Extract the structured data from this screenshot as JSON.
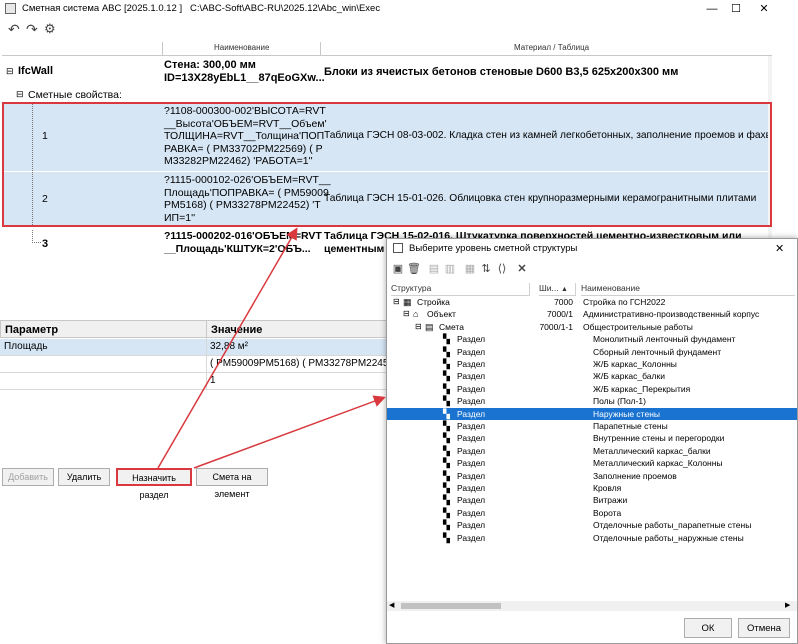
{
  "window": {
    "title": "Сметная система ABC [2025.1.0.12 ]",
    "path": "C:\\ABC-Soft\\ABC-RU\\2025.12\\Abc_win\\Exec"
  },
  "columns": {
    "name": "Наименование",
    "material": "Материал / Таблица"
  },
  "tree": {
    "root_label": "IfcWall",
    "root_name_line1": "Стена: 300,00 мм",
    "root_name_line2": "ID=13X28yEbL1__87qEoGXw...",
    "root_material": "Блоки из ячеистых бетонов стеновые D600 B3,5 625x200x300 мм",
    "props_label": "Сметные свойства:",
    "items": [
      {
        "num": "1",
        "code": [
          "?1108-000300-002'ВЫСОТА=RVT",
          "__Высота'ОБЪЕМ=RVT__Объем'",
          "ТОЛЩИНА=RVT__Толщина'ПОП",
          "РАВКА= ( PM33702PM22569)    ( P",
          "M33282PM22462)  'РАБОТА=1''"
        ],
        "table": "Таблица ГЭСН 08-03-002. Кладка стен из камней легкобетонных, заполнение проемов и фахверков"
      },
      {
        "num": "2",
        "code": [
          "?1115-000102-026'ОБЪЕМ=RVT__",
          "Площадь'ПОПРАВКА= ( PM59009",
          "PM5168)    ( PM33278PM22452)  'Т",
          "ИП=1''"
        ],
        "table": "Таблица ГЭСН 15-01-026. Облицовка стен крупноразмерными керамогранитными плитами"
      },
      {
        "num": "3",
        "code": [
          "?1115-000202-016'ОБЪЕМ=RVT",
          "__Площадь'КШТУК=2'ОБЪ..."
        ],
        "table": [
          "Таблица ГЭСН 15-02-016. Штукатурка поверхностей цементно-известковым или",
          "цементным р..."
        ]
      }
    ]
  },
  "params": {
    "col_param": "Параметр",
    "col_value": "Значение",
    "rows": [
      {
        "name": "Площадь",
        "value": "32,88  м²"
      },
      {
        "name": "",
        "value": "( PM59009PM5168)     ( PM33278PM2245"
      },
      {
        "name": "",
        "value": "1"
      }
    ]
  },
  "buttons": {
    "add": "Добавить",
    "delete": "Удалить",
    "assign": "Назначить раздел",
    "estimate": "Смета на элемент"
  },
  "dialog": {
    "title": "Выберите уровень сметной структуры",
    "col_struct": "Структура",
    "col_code": "Ши...",
    "col_name": "Наименование",
    "rows": [
      {
        "label": "Стройка",
        "code": "7000",
        "name": "Стройка по ГСН2022"
      },
      {
        "label": "Объект",
        "code": "7000/1",
        "name": "Административно-производственный корпус"
      },
      {
        "label": "Смета",
        "code": "7000/1-1",
        "name": "Общестроительные работы"
      },
      {
        "label": "Раздел",
        "code": "",
        "name": "Монолитный ленточный фундамент"
      },
      {
        "label": "Раздел",
        "code": "",
        "name": "Сборный ленточный фундамент"
      },
      {
        "label": "Раздел",
        "code": "",
        "name": "Ж/Б каркас_Колонны"
      },
      {
        "label": "Раздел",
        "code": "",
        "name": "Ж/Б каркас_балки"
      },
      {
        "label": "Раздел",
        "code": "",
        "name": "Ж/Б каркас_Перекрытия"
      },
      {
        "label": "Раздел",
        "code": "",
        "name": "Полы (Пол-1)"
      },
      {
        "label": "Раздел",
        "code": "",
        "name": "Наружные стены"
      },
      {
        "label": "Раздел",
        "code": "",
        "name": "Парапетные стены"
      },
      {
        "label": "Раздел",
        "code": "",
        "name": "Внутренние стены и перегородки"
      },
      {
        "label": "Раздел",
        "code": "",
        "name": "Металлический каркас_балки"
      },
      {
        "label": "Раздел",
        "code": "",
        "name": "Металлический каркас_Колонны"
      },
      {
        "label": "Раздел",
        "code": "",
        "name": "Заполнение проемов"
      },
      {
        "label": "Раздел",
        "code": "",
        "name": "Кровля"
      },
      {
        "label": "Раздел",
        "code": "",
        "name": "Витражи"
      },
      {
        "label": "Раздел",
        "code": "",
        "name": "Ворота"
      },
      {
        "label": "Раздел",
        "code": "",
        "name": "Отделочные работы_парапетные стены"
      },
      {
        "label": "Раздел",
        "code": "",
        "name": "Отделочные работы_наружные стены"
      }
    ],
    "ok": "ОК",
    "cancel": "Отмена"
  },
  "colors": {
    "highlight": "#1a73d0",
    "selection": "#d6e6f5",
    "annotation": "#d9393e"
  }
}
